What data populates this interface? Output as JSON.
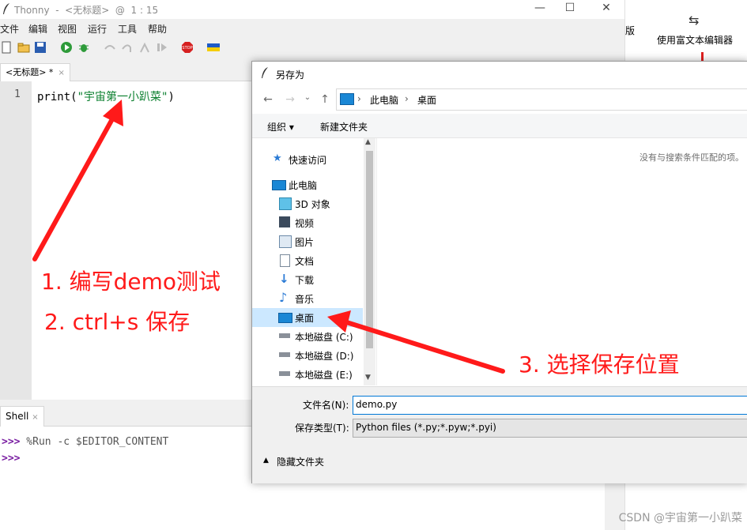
{
  "thonny": {
    "window_title": "Thonny  -  <无标题>  @  1 : 15",
    "menu": [
      "文件",
      "编辑",
      "视图",
      "运行",
      "工具",
      "帮助"
    ],
    "editor_tab": "<无标题> *",
    "line_number": "1",
    "code_fn": "print(",
    "code_str": "\"宇宙第一小趴菜\"",
    "code_end": ")",
    "shell_tab": "Shell",
    "shell_lines": [
      {
        "prompt": ">>>",
        "text": " %Run -c $EDITOR_CONTENT"
      },
      {
        "prompt": ">>>",
        "text": ""
      }
    ]
  },
  "right_panel": {
    "partial_label": "版",
    "rich_editor_label": "使用富文本编辑器",
    "rich_editor_icon": "swap-icon"
  },
  "dialog": {
    "title": "另存为",
    "address": {
      "root": "此电脑",
      "current": "桌面"
    },
    "toolbar": {
      "organize": "组织 ▾",
      "new_folder": "新建文件夹"
    },
    "nav_items": [
      {
        "label": "快速访问",
        "icon": "star-icon"
      },
      {
        "label": "此电脑",
        "icon": "computer-icon"
      },
      {
        "label": "3D 对象",
        "icon": "cube-icon"
      },
      {
        "label": "视频",
        "icon": "video-icon"
      },
      {
        "label": "图片",
        "icon": "picture-icon"
      },
      {
        "label": "文档",
        "icon": "document-icon"
      },
      {
        "label": "下载",
        "icon": "download-icon"
      },
      {
        "label": "音乐",
        "icon": "music-icon"
      },
      {
        "label": "桌面",
        "icon": "desktop-icon",
        "selected": true
      },
      {
        "label": "本地磁盘 (C:)",
        "icon": "drive-icon"
      },
      {
        "label": "本地磁盘 (D:)",
        "icon": "drive-icon"
      },
      {
        "label": "本地磁盘 (E:)",
        "icon": "drive-icon"
      }
    ],
    "empty_message": "没有与搜索条件匹配的项。",
    "filename_label": "文件名(N):",
    "filename_value": "demo.py",
    "filetype_label": "保存类型(T):",
    "filetype_value": "Python files (*.py;*.pyw;*.pyi)",
    "hide_folders": "隐藏文件夹"
  },
  "annotations": {
    "step1": "1. 编写demo测试",
    "step2": "2. ctrl+s 保存",
    "step3": "3. 选择保存位置",
    "color": "#ff1a1a"
  },
  "watermark": "CSDN @宇宙第一小趴菜"
}
